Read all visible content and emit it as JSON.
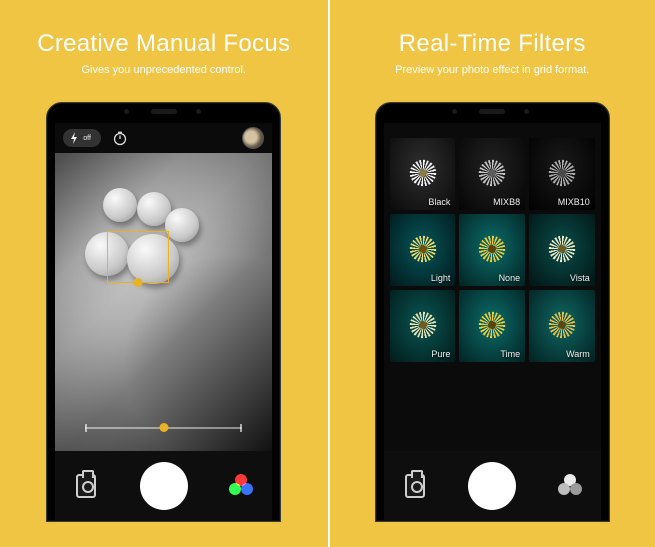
{
  "left": {
    "headline": "Creative Manual Focus",
    "subhead": "Gives you unprecedented control.",
    "camera": {
      "flash_label": "off",
      "timer_icon": "timer-icon",
      "gallery_thumb": "gallery-thumbnail"
    }
  },
  "right": {
    "headline": "Real-Time Filters",
    "subhead": "Preview your photo effect in grid format.",
    "filters": [
      {
        "name": "Black"
      },
      {
        "name": "MIXB8"
      },
      {
        "name": "MIXB10"
      },
      {
        "name": "Light"
      },
      {
        "name": "None"
      },
      {
        "name": "Vista"
      },
      {
        "name": "Pure"
      },
      {
        "name": "Time"
      },
      {
        "name": "Warm"
      }
    ]
  }
}
